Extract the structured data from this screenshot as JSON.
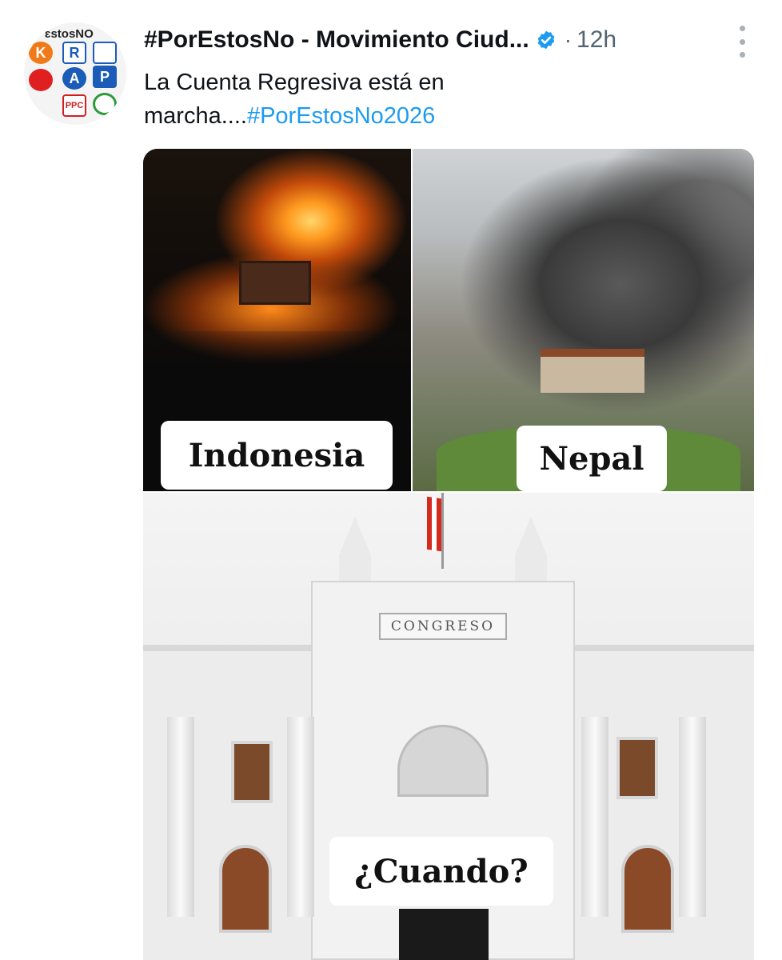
{
  "avatar": {
    "tag": "ɛstosNO",
    "logos": [
      "K",
      "R",
      "A",
      "P",
      "PPC"
    ]
  },
  "post": {
    "author": "#PorEstosNo - Movimiento Ciud...",
    "verified_icon": "verified-badge-icon",
    "separator": "·",
    "time": "12h",
    "more_icon": "more-vertical-icon",
    "text_before": "La Cuenta Regresiva está en marcha....",
    "hashtag": "#PorEstosNo2026"
  },
  "media": {
    "panel_1_label": "Indonesia",
    "panel_2_label": "Nepal",
    "panel_3_label": "¿Cuando?",
    "building_plaque": "CONGRESO"
  },
  "colors": {
    "hashtag": "#1d9bf0",
    "verified": "#1d9bf0",
    "secondary_text": "#536471"
  }
}
